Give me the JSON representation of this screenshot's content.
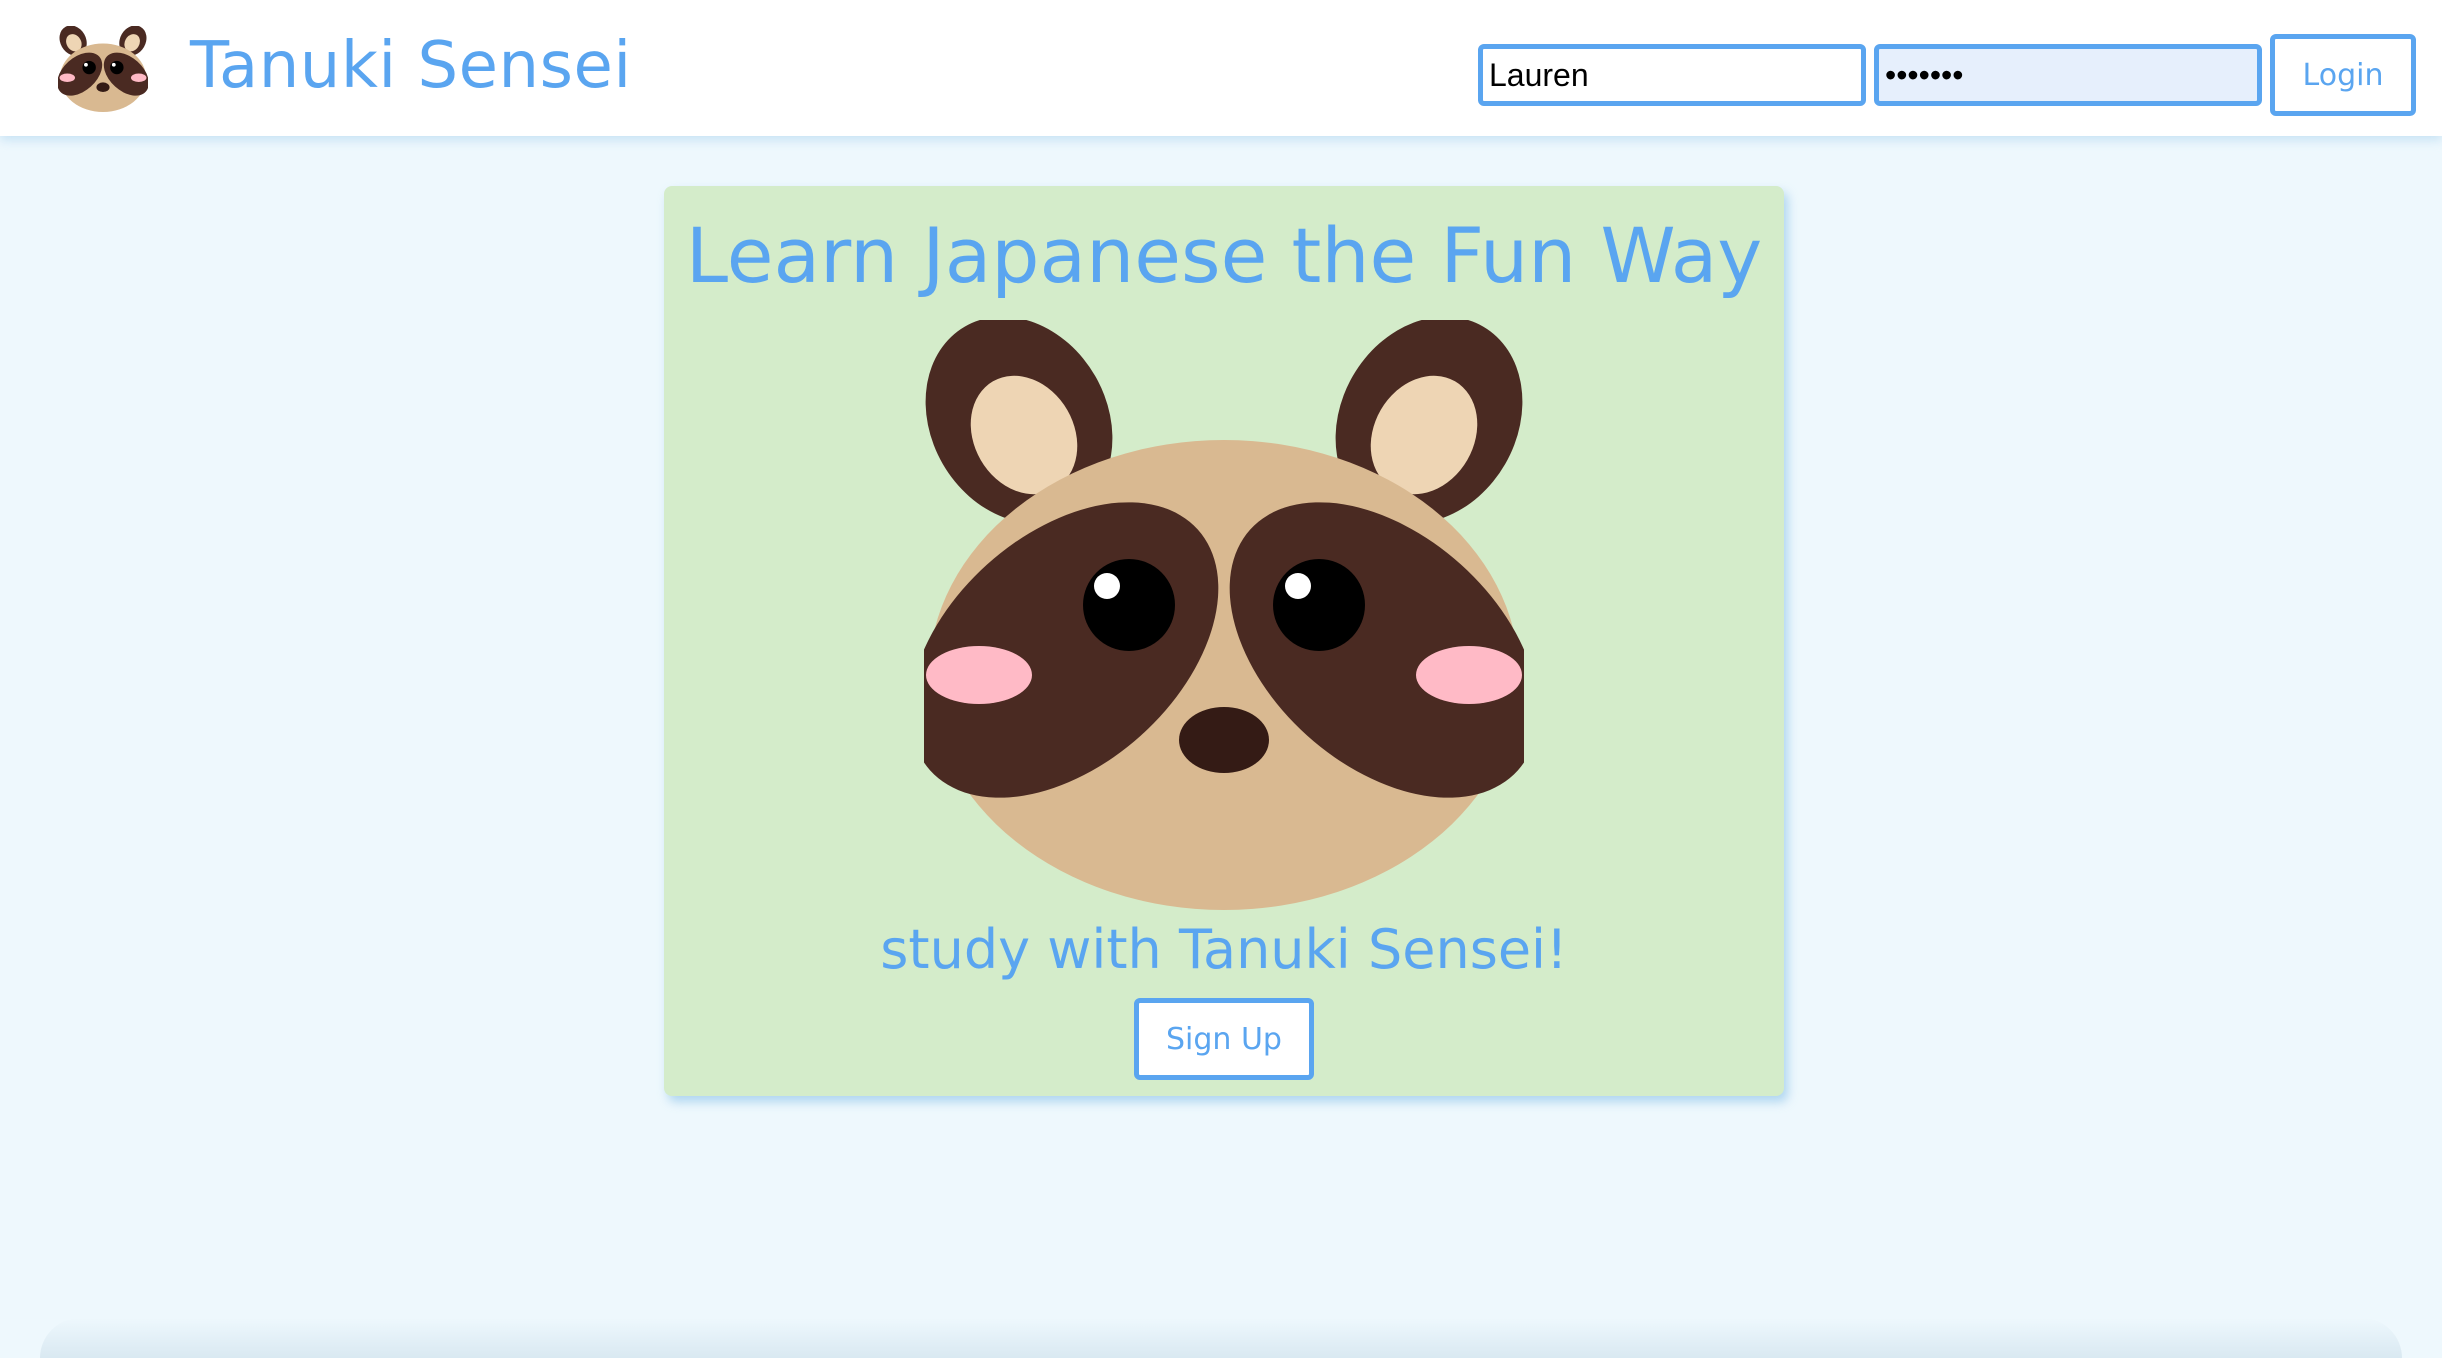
{
  "header": {
    "brand_name": "Tanuki Sensei",
    "logo_icon": "tanuki-face-icon",
    "username_value": "Lauren",
    "password_value": "•••••••",
    "login_label": "Login"
  },
  "hero": {
    "title": "Learn Japanese the Fun Way",
    "illustration": "tanuki-face-icon",
    "subtitle": "study with Tanuki Sensei!",
    "signup_label": "Sign Up"
  },
  "colors": {
    "accent_blue": "#5aa5f0",
    "page_background": "#eef8fd",
    "card_background": "#d4ecca",
    "tanuki_fur": "#d9b991",
    "tanuki_dark": "#4a2a22",
    "tanuki_ear_inner": "#eed5b4",
    "blush_pink": "#ffbac6"
  }
}
